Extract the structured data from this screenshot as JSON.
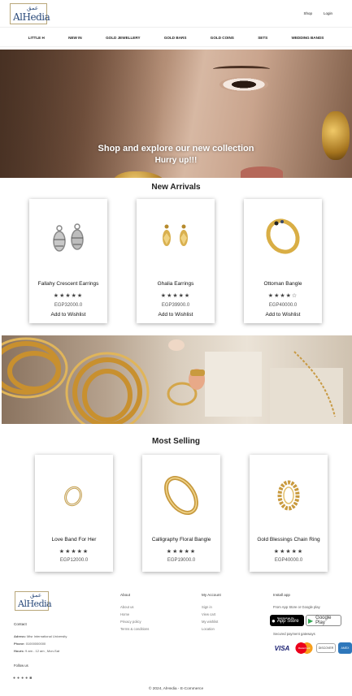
{
  "brand": {
    "name_ar": "عمق",
    "name_en": "AlHedia"
  },
  "topnav": {
    "shop": "Shop",
    "login": "Login"
  },
  "menu": [
    "LITTLE H",
    "NEW IN",
    "GOLD JEWELLERY",
    "GOLD BARS",
    "GOLD COINS",
    "SETS",
    "WEDDING BANDS"
  ],
  "hero": {
    "title": "Shop and explore our new collection",
    "subtitle": "Hurry up!!!"
  },
  "new_arrivals": {
    "title": "New Arrivals",
    "items": [
      {
        "name": "Fallahy Crescent Earrings",
        "rating": "★★★★★",
        "price": "EGP32000.0",
        "wishlist": "Add to Wishlist"
      },
      {
        "name": "Ghalia Earrings",
        "rating": "★★★★★",
        "price": "EGP39900.0",
        "wishlist": "Add to Wishlist"
      },
      {
        "name": "Ottoman Bangle",
        "rating": "★★★★☆",
        "price": "EGP40000.0",
        "wishlist": "Add to Wishlist"
      }
    ]
  },
  "most_selling": {
    "title": "Most Selling",
    "items": [
      {
        "name": "Love Band For Her",
        "rating": "★★★★★",
        "price": "EGP12000.0"
      },
      {
        "name": "Calligraphy Floral Bangle",
        "rating": "★★★★★",
        "price": "EGP19000.0"
      },
      {
        "name": "Gold Blessings Chain Ring",
        "rating": "★★★★★",
        "price": "EGP40000.0"
      }
    ]
  },
  "footer": {
    "contact_title": "Contact",
    "address_label": "Adress:",
    "address": "Misr International University",
    "phone_label": "Phone:",
    "phone": "01000000000",
    "hours_label": "Hours:",
    "hours": "9 am - 12 am , Mon-Sat",
    "follow": "Follow us",
    "about_title": "About",
    "about_links": [
      "About us",
      "Home",
      "Privacy policy",
      "Terms & conditions"
    ],
    "account_title": "My Account",
    "account_links": [
      "Sign in",
      "View cart",
      "My wishlist",
      "Location"
    ],
    "app_title": "Install app",
    "app_text": "From App Store or Google play",
    "appstore_small": "Download on the",
    "appstore": "App Store",
    "googleplay": "Google Play",
    "payment_text": "Secured payment gateways",
    "cards": [
      "VISA",
      "MasterCard",
      "DISCOVER",
      "AMEX"
    ],
    "copyright": "© 2024, AlHedia - E-Commerce"
  },
  "colors": {
    "gold": "#c9a14a",
    "navy": "#2a4a7a",
    "visa": "#1a1f71",
    "amex": "#2e77bb"
  }
}
